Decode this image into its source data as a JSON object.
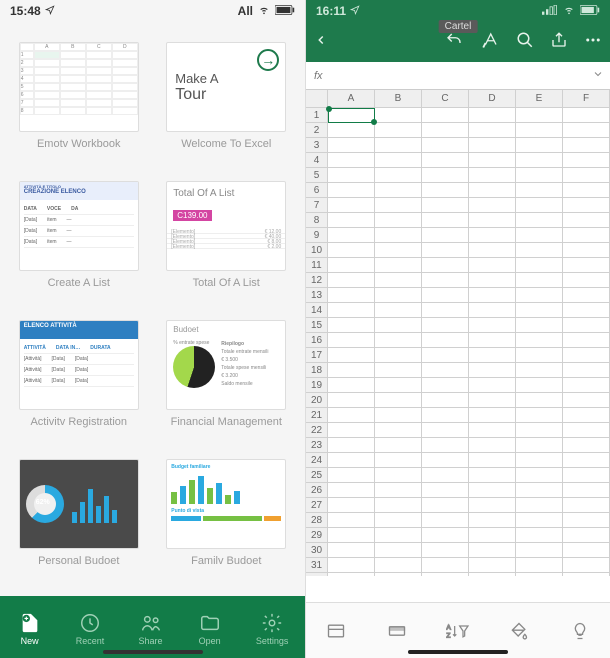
{
  "left": {
    "status": {
      "time": "15:48",
      "carrier_text": "All"
    },
    "templates": [
      {
        "label": "Emotv Workbook"
      },
      {
        "label": "Welcome To Excel",
        "line1": "Make A",
        "line2": "Tour"
      },
      {
        "label": "Create A List",
        "header": "CREAZIONE ELENCO",
        "subheader": "ATTIVITÀ E TITOLO"
      },
      {
        "label": "Total Of A List",
        "title": "Total Of A List",
        "value": "C139.00"
      },
      {
        "label": "Activitv Registration",
        "header": "ELENCO ATTIVITÀ"
      },
      {
        "label": "Financial Management",
        "title": "Budoet",
        "left_label": "% entrate spese",
        "right_label": "Riepilogo"
      },
      {
        "label": "Personal Budoet",
        "pct": "62%"
      },
      {
        "label": "Familv Budoet",
        "title": "Budget familiare",
        "subtitle": "Punto di vista"
      }
    ],
    "tabs": [
      {
        "label": "New",
        "icon": "new"
      },
      {
        "label": "Recent",
        "icon": "recent"
      },
      {
        "label": "Share",
        "icon": "share"
      },
      {
        "label": "Open",
        "icon": "open"
      },
      {
        "label": "Settings",
        "icon": "settings"
      }
    ]
  },
  "right": {
    "status": {
      "time": "16:11"
    },
    "title_badge": "Cartel",
    "formula": {
      "fx": "fx",
      "value": ""
    },
    "columns": [
      "A",
      "B",
      "C",
      "D",
      "E",
      "F"
    ],
    "row_count": 37,
    "selected_cell": "A1"
  }
}
